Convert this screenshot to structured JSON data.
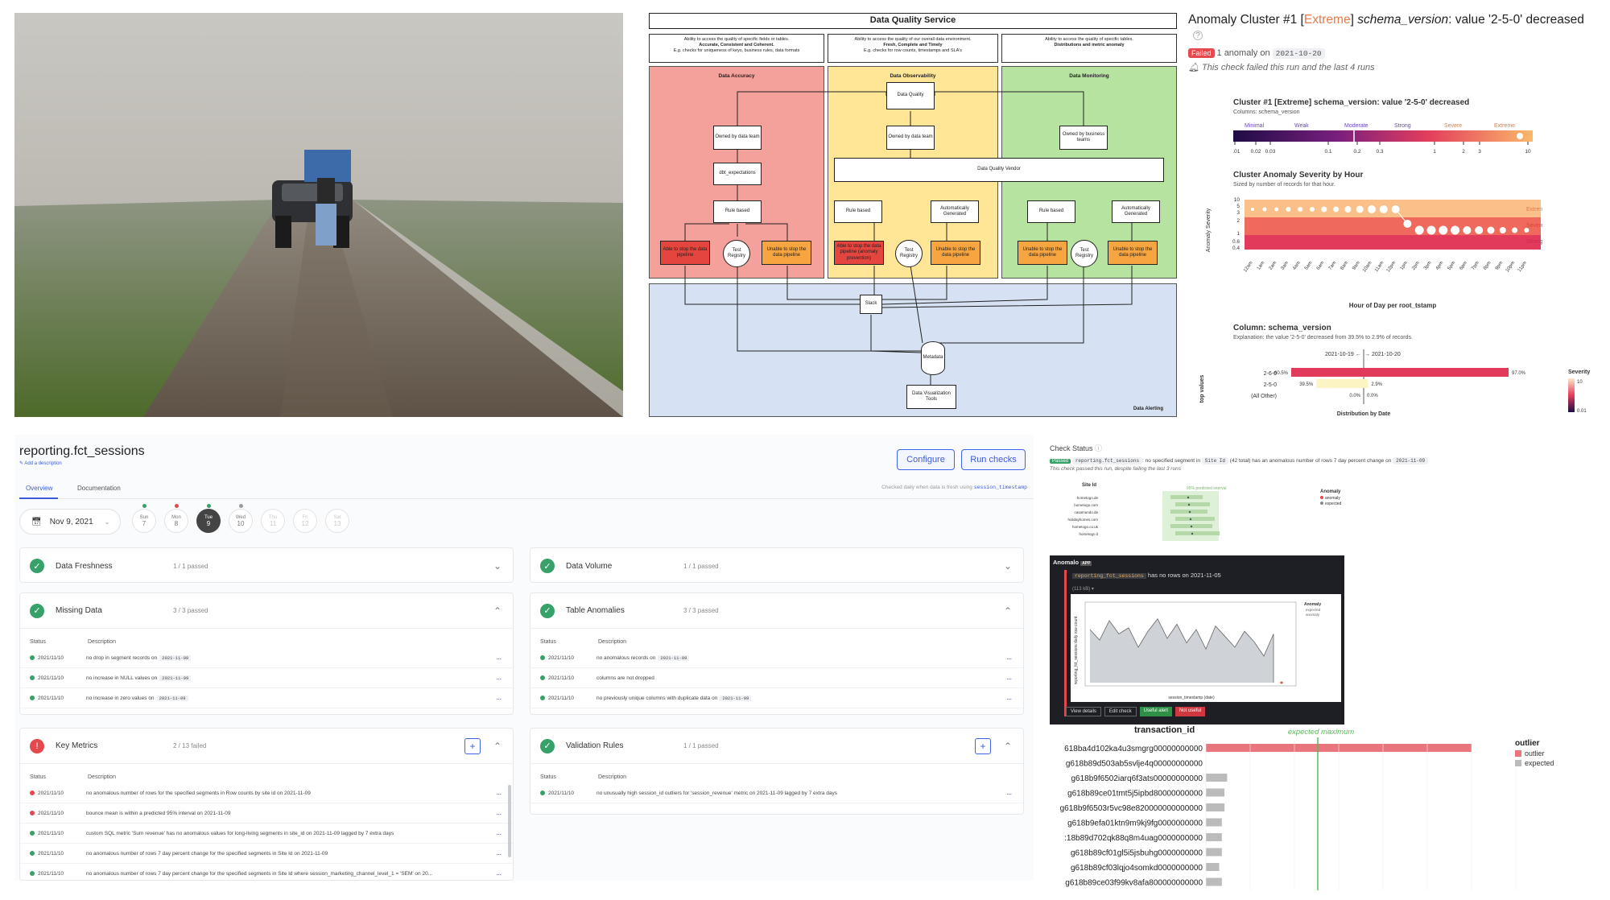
{
  "diagram": {
    "title": "Data Quality Service",
    "descriptions": [
      [
        "Ability to access the quality of specific fields or tables.",
        "Accurate, Consistent and Coherent.",
        "E.g. checks for uniqueness of keys, business rules, data formats"
      ],
      [
        "Ability to access the quality of our overall data environment.",
        "Fresh, Complete and Timely",
        "E.g. checks for row counts, timestamps and SLA's"
      ],
      [
        "Ability to access the quality of specific tables.",
        "Distributions and metric anomaly",
        ""
      ]
    ],
    "zones": [
      "Data Accuracy",
      "Data Observability",
      "Data Monitoring"
    ],
    "boxes": {
      "data_quality": "Data Quality",
      "owned_data_team": "Owned by data team",
      "owned_business": "Owned by business teams",
      "dbt": "dbt_expectations",
      "rule_based": "Rule based",
      "auto": "Automatically Generated",
      "vendor": "Data Quality Vendor",
      "able": "Able to stop the data pipeline",
      "able_prev": "Able to stop the data pipeline (anomaly prevention)",
      "unable": "Unable to stop the data pipeline",
      "registry": "Test Registry",
      "slack": "Slack",
      "metadata": "Metadata",
      "viz": "Data Visualization Tools"
    },
    "alerting": "Data Alerting"
  },
  "anomaly": {
    "title_prefix": "Anomaly Cluster #1 [",
    "title_level": "Extreme",
    "title_mid": "] ",
    "title_col": "schema_version",
    "title_suffix": ": value '2-5-0' decreased",
    "help_icon": "?",
    "badge": "Failed",
    "count_text": "1 anomaly on",
    "date": "2021-10-20",
    "note": "This check failed this run and the last 4 runs",
    "cluster_title": "Cluster #1 [Extreme] schema_version: value '2-5-0' decreased",
    "columns": "Columns: schema_version",
    "severity_labels": [
      "Minimal",
      "Weak",
      "Moderate",
      "Strong",
      "Severe",
      "Extreme"
    ],
    "severity_ticks": [
      "0.01",
      "0.02",
      "0.03",
      "0.1",
      "0.2",
      "0.3",
      "1",
      "2",
      "3",
      "10"
    ],
    "hour_title": "Cluster Anomaly Severity by Hour",
    "hour_sub": "Sized by number of records for that hour.",
    "hour_ylabel": "Anomaly Severity",
    "hour_yticks": [
      "10",
      "5",
      "3",
      "2",
      "1",
      "0.6",
      "0.4"
    ],
    "hour_bands": [
      "Extreme",
      "Severe",
      "Strong"
    ],
    "hour_xlabel": "Hour of Day per root_tstamp",
    "hours": [
      "12am",
      "1am",
      "2am",
      "3am",
      "4am",
      "5am",
      "6am",
      "7am",
      "8am",
      "9am",
      "10am",
      "11am",
      "12pm",
      "1pm",
      "2pm",
      "3pm",
      "4pm",
      "5pm",
      "6pm",
      "7pm",
      "8pm",
      "9pm",
      "10pm",
      "11pm"
    ],
    "col_title": "Column: schema_version",
    "col_expl": "Explanation: the value '2-5-0' decreased from 39.5% to 2.9% of records.",
    "dist_from": "2021-10-19 ←",
    "dist_to": "→ 2021-10-20",
    "dist_ylabel": "top values",
    "dist_xlabel": "Distribution by Date",
    "dist_rows": [
      {
        "label": "2-6-0",
        "left": "60.5%",
        "right": "97.0%",
        "lv": 60.5,
        "rv": 97.0
      },
      {
        "label": "2-5-0",
        "left": "39.5%",
        "right": "2.9%",
        "lv": 39.5,
        "rv": 2.9
      },
      {
        "label": "(All Other)",
        "left": "0.0%",
        "right": "0.0%",
        "lv": 0,
        "rv": 0
      }
    ],
    "legend_title": "Severity",
    "legend_max": "10",
    "legend_min": "0.01"
  },
  "dash": {
    "table": "reporting.fct_sessions",
    "add_desc": "Add a description",
    "tabs": [
      "Overview",
      "Documentation"
    ],
    "configure": "Configure",
    "run": "Run checks",
    "checked": "Checked daily when data is fresh using",
    "checked_col": "session_timestamp",
    "date": "Nov 9, 2021",
    "days": [
      {
        "d": "Sun",
        "n": "7"
      },
      {
        "d": "Mon",
        "n": "8"
      },
      {
        "d": "Tue",
        "n": "9"
      },
      {
        "d": "Wed",
        "n": "10"
      },
      {
        "d": "Thu",
        "n": "11"
      },
      {
        "d": "Fri",
        "n": "12"
      },
      {
        "d": "Sat",
        "n": "13"
      }
    ],
    "col_status": "Status",
    "col_desc": "Description",
    "row_date": "2021/11/10",
    "cards": {
      "freshness": {
        "title": "Data Freshness",
        "pass": "1 / 1 passed"
      },
      "volume": {
        "title": "Data Volume",
        "pass": "1 / 1 passed"
      },
      "missing": {
        "title": "Missing Data",
        "pass": "3 / 3 passed"
      },
      "anomalies": {
        "title": "Table Anomalies",
        "pass": "3 / 3 passed"
      },
      "metrics": {
        "title": "Key Metrics",
        "pass": "2 / 13 failed"
      },
      "validation": {
        "title": "Validation Rules",
        "pass": "1 / 1 passed"
      }
    },
    "missing_rows": [
      [
        "no drop in segment records on",
        "2021-11-09"
      ],
      [
        "no increase in NULL values on",
        "2021-11-09"
      ],
      [
        "no increase in zero values on",
        "2021-11-09"
      ]
    ],
    "anomaly_rows": [
      [
        "no anomalous records on",
        "2021-11-09"
      ],
      [
        "columns are not dropped",
        ""
      ],
      [
        "no previously unique columns with duplicate data on",
        "2021-11-09"
      ]
    ],
    "metric_rows": [
      "no anomalous number of rows for the specified segments in  Row counts by site id  on  2021-11-09",
      "bounce  mean is within a predicted 95% interval on  2021-11-09",
      "custom SQL metric 'Sum revenue' has no anomalous values for long-living segments in  site_id  on  2021-11-09  lagged by 7 extra days",
      "no anomalous number of rows 7 day percent change for the specified segments in  Site Id  on  2021-11-09",
      "no anomalous number of rows 7 day percent change for the specified segments in  Site Id  where  session_marketing_channel_level_1 = 'SEM'  on  20..."
    ],
    "validation_row": "no unusually high  session_id  outliers for  'session_revenue'  metric on  2021-11-09  lagged by 7 extra days"
  },
  "check": {
    "title": "Check Status",
    "badge": "Passed",
    "table": "reporting.fct_sessions",
    "text1": ": no specified segment in",
    "seg": "Site Id",
    "text2": "(42 total) has an anomalous number of rows 7 day percent change on",
    "date": "2021-11-09",
    "note": "This check passed this run, despite failing the last 3 runs",
    "site_header": "Site Id",
    "interval_label": "95% predicted interval",
    "sites": [
      "hometogo.de",
      "hometogo.com",
      "casamundo.de",
      "holidayhomes.com",
      "hometogo.co.uk",
      "hometogo.it"
    ],
    "legend_title": "Anomaly",
    "legend": [
      "anomaly",
      "expected"
    ]
  },
  "anomalo": {
    "app": "Anomalo",
    "app_badge": "APP",
    "table": "reporting_fct_sessions",
    "text": "has no rows on 2021-11-05",
    "sub": "(113 kB) ▾",
    "ylabel": "reporting_fct_sessions daily row count",
    "xlabel": "session_timestamp (date)",
    "legend_title": "Anomaly",
    "legend": [
      "expected",
      "anomaly"
    ],
    "buttons": [
      "View details",
      "Edit check",
      "Useful alert",
      "Not useful"
    ]
  },
  "txn": {
    "title": "transaction_id",
    "expected_max": "expected maximum",
    "ids": [
      "618ba4d102ka4u3smgrg00000000000",
      "g618b89d503ab5svlje4q00000000000",
      "g618b9f6502iarq6f3ats00000000000",
      "g618b89ce01tmt5j5ipbd80000000000",
      "g618b9f6503r5vc98e820000000000000",
      "g618b9efa01ktn9m9kj9fg0000000000",
      ":18b89d702qk88q8m4uag0000000000",
      "g618b89cf01gl5i5jsbuhg0000000000",
      "g618b89cf03lqjo4somkd0000000000",
      "g618b89ce03f99kv8afa800000000000"
    ],
    "values": [
      100,
      0,
      8,
      7,
      7,
      6,
      6,
      6,
      5,
      6
    ],
    "legend_title": "outlier",
    "legend": [
      "outlier",
      "expected"
    ]
  }
}
